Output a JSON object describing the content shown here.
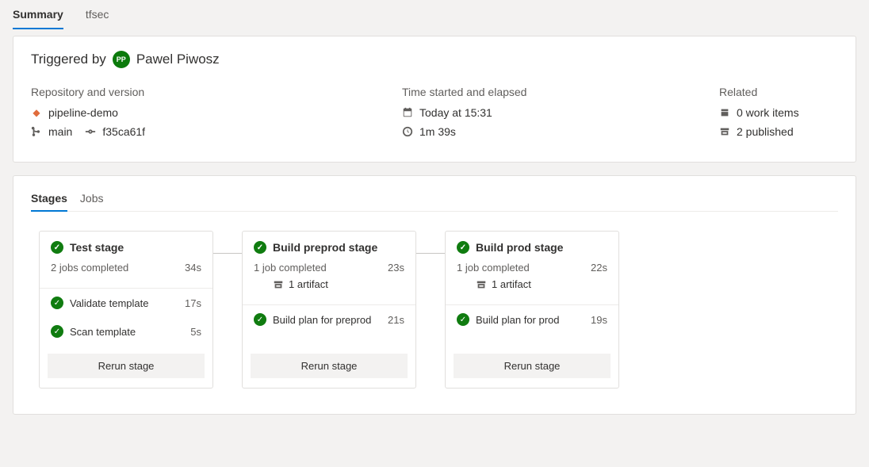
{
  "tabs": {
    "summary": "Summary",
    "tfsec": "tfsec"
  },
  "triggered": {
    "label": "Triggered by",
    "initials": "PP",
    "name": "Pawel Piwosz"
  },
  "meta": {
    "repo_heading": "Repository and version",
    "repo_name": "pipeline-demo",
    "branch": "main",
    "commit": "f35ca61f",
    "time_heading": "Time started and elapsed",
    "started": "Today at 15:31",
    "elapsed": "1m 39s",
    "related_heading": "Related",
    "work_items": "0 work items",
    "published": "2 published"
  },
  "stages_tabs": {
    "stages": "Stages",
    "jobs": "Jobs"
  },
  "stages": [
    {
      "title": "Test stage",
      "summary": "2 jobs completed",
      "duration": "34s",
      "artifact": null,
      "jobs": [
        {
          "name": "Validate template",
          "duration": "17s"
        },
        {
          "name": "Scan template",
          "duration": "5s"
        }
      ],
      "rerun": "Rerun stage"
    },
    {
      "title": "Build preprod stage",
      "summary": "1 job completed",
      "duration": "23s",
      "artifact": "1 artifact",
      "jobs": [
        {
          "name": "Build plan for preprod",
          "duration": "21s"
        }
      ],
      "rerun": "Rerun stage"
    },
    {
      "title": "Build prod stage",
      "summary": "1 job completed",
      "duration": "22s",
      "artifact": "1 artifact",
      "jobs": [
        {
          "name": "Build plan for prod",
          "duration": "19s"
        }
      ],
      "rerun": "Rerun stage"
    }
  ]
}
